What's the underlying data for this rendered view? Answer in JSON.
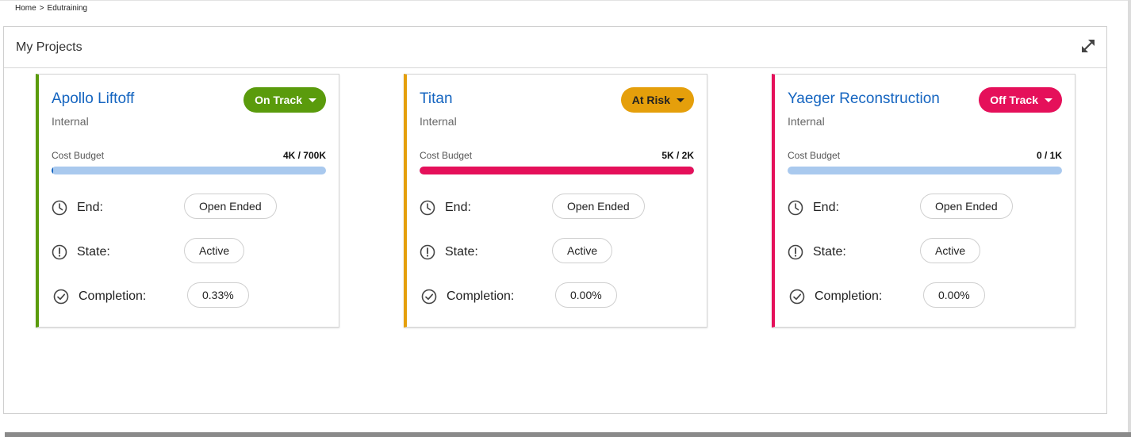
{
  "breadcrumb": {
    "home": "Home",
    "separator": ">",
    "current": "Edutraining"
  },
  "panel": {
    "title": "My Projects",
    "expand_icon": "expand-arrows-icon"
  },
  "labels": {
    "cost_budget": "Cost Budget",
    "end": "End:",
    "state": "State:",
    "completion": "Completion:"
  },
  "projects": [
    {
      "name": "Apollo Liftoff",
      "type": "Internal",
      "status": "On Track",
      "status_color": "#5a9b0c",
      "status_text_color": "#ffffff",
      "budget": "4K / 700K",
      "budget_fraction": 0.006,
      "bar_fill_color": "#1565c0",
      "end": "Open Ended",
      "state": "Active",
      "completion": "0.33%"
    },
    {
      "name": "Titan",
      "type": "Internal",
      "status": "At Risk",
      "status_color": "#e59f0b",
      "status_text_color": "#222222",
      "budget": "5K / 2K",
      "budget_fraction": 1.0,
      "bar_fill_color": "#e5105a",
      "end": "Open Ended",
      "state": "Active",
      "completion": "0.00%"
    },
    {
      "name": "Yaeger Reconstruction",
      "type": "Internal",
      "status": "Off Track",
      "status_color": "#e5105a",
      "status_text_color": "#ffffff",
      "budget": "0 / 1K",
      "budget_fraction": 0.0,
      "bar_fill_color": "#1565c0",
      "end": "Open Ended",
      "state": "Active",
      "completion": "0.00%"
    }
  ]
}
